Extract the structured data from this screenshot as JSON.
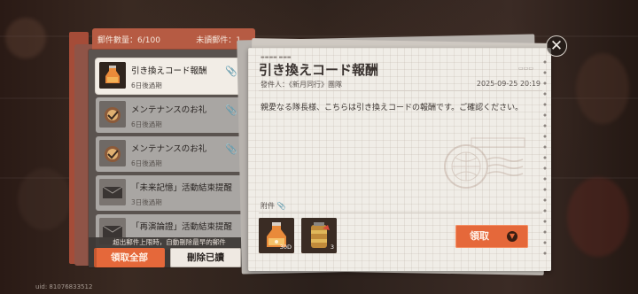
{
  "header": {
    "mail_count": "郵件數量：6/100",
    "unread_count": "未讀郵件：1"
  },
  "mails": [
    {
      "title": "引き換えコード報酬",
      "expiry": "6日後過期",
      "attachment_icon": "paperclip-icon",
      "selected": true
    },
    {
      "title": "メンテナンスのお礼",
      "expiry": "6日後過期",
      "attachment_icon": "paperclip-icon",
      "selected": false
    },
    {
      "title": "メンテナンスのお礼",
      "expiry": "6日後過期",
      "attachment_icon": "paperclip-icon",
      "selected": false
    },
    {
      "title": "「未来記憶」活動結束提醒",
      "expiry": "3日後過期",
      "selected": false
    },
    {
      "title": "「再演論證」活動結束提醒",
      "expiry": "",
      "selected": false
    }
  ],
  "list_footer": {
    "limit_note": "超出郵件上限時，自動刪除最早的郵件",
    "claim_all_label": "領取全部",
    "delete_read_label": "刪除已讀"
  },
  "letter": {
    "title": "引き換えコード報酬",
    "sender": "發件人：《新月同行》團隊",
    "date": "2025-09-25 20:19",
    "body": "親愛なる隊長様、こちらは引き換えコードの報酬です。ご確認ください。",
    "attachments_label": "附件",
    "attachments": [
      {
        "item": "orange-potion-icon",
        "quantity": "30D"
      },
      {
        "item": "energy-canister-icon",
        "quantity": "3"
      }
    ],
    "claim_label": "領取"
  },
  "uid_text": "uid: 81076833512",
  "colors": {
    "accent": "#e5683a",
    "folder": "#b65b43",
    "paper": "#f0ede7"
  }
}
